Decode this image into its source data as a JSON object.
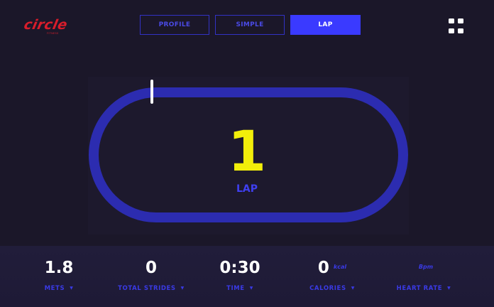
{
  "brand": {
    "logo_text": "circle",
    "logo_subtext": "FITNESS",
    "logo_color": "#d81d2b"
  },
  "tabs": [
    {
      "label": "PROFILE",
      "active": false
    },
    {
      "label": "SIMPLE",
      "active": false
    },
    {
      "label": "LAP",
      "active": true
    }
  ],
  "menu": {
    "icon": "grid-icon"
  },
  "track": {
    "lap_count": "1",
    "lap_label": "LAP",
    "track_color": "#2c2cb0",
    "marker_color": "#ffffff",
    "number_color": "#f2ee0a"
  },
  "stats": [
    {
      "value": "1.8",
      "unit": "",
      "label": "METS"
    },
    {
      "value": "0",
      "unit": "",
      "label": "TOTAL STRIDES"
    },
    {
      "value": "0:30",
      "unit": "",
      "label": "TIME"
    },
    {
      "value": "0",
      "unit": "kcal",
      "label": "CALORIES"
    },
    {
      "value": "",
      "unit": "Bpm",
      "label": "HEART RATE"
    }
  ],
  "arrow_glyph": "▼"
}
